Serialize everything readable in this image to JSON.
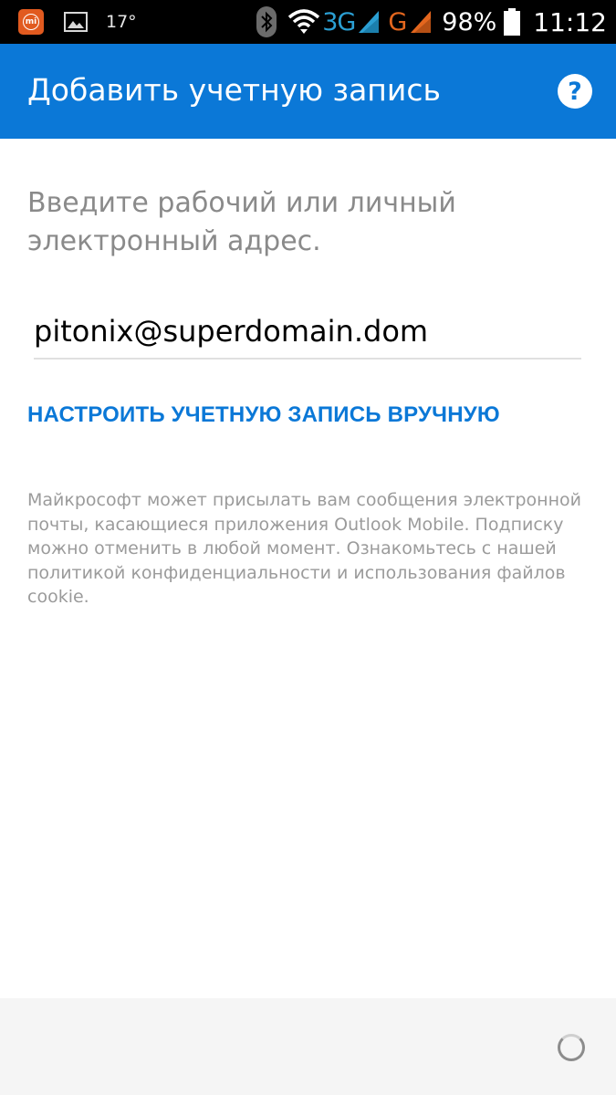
{
  "status_bar": {
    "temperature": "17°",
    "network_3g": "3G",
    "network_g": "G",
    "battery": "98%",
    "time": "11:12",
    "icons": [
      "mi-icon",
      "gallery-icon",
      "bluetooth-icon",
      "wifi-icon",
      "signal-icon",
      "battery-icon"
    ],
    "colors": {
      "3g": "#2b9fd3",
      "g": "#e3661e",
      "mi": "#e15a1f"
    }
  },
  "app_bar": {
    "title": "Добавить учетную запись",
    "help_icon": "help-icon",
    "color": "#0b78d7"
  },
  "form": {
    "prompt": "Введите рабочий или личный электронный адрес.",
    "email_value": "pitonix@superdomain.dom",
    "manual_setup_label": "НАСТРОИТЬ УЧЕТНУЮ ЗАПИСЬ ВРУЧНУЮ"
  },
  "disclaimer": "Майкрософт может присылать вам сообщения электронной почты, касающиеся приложения Outlook Mobile. Подписку можно отменить в любой момент. Ознакомьтесь с нашей политикой конфиденциальности и использования файлов cookie.",
  "bottom_bar": {
    "spinner_icon": "loading-spinner-icon"
  }
}
